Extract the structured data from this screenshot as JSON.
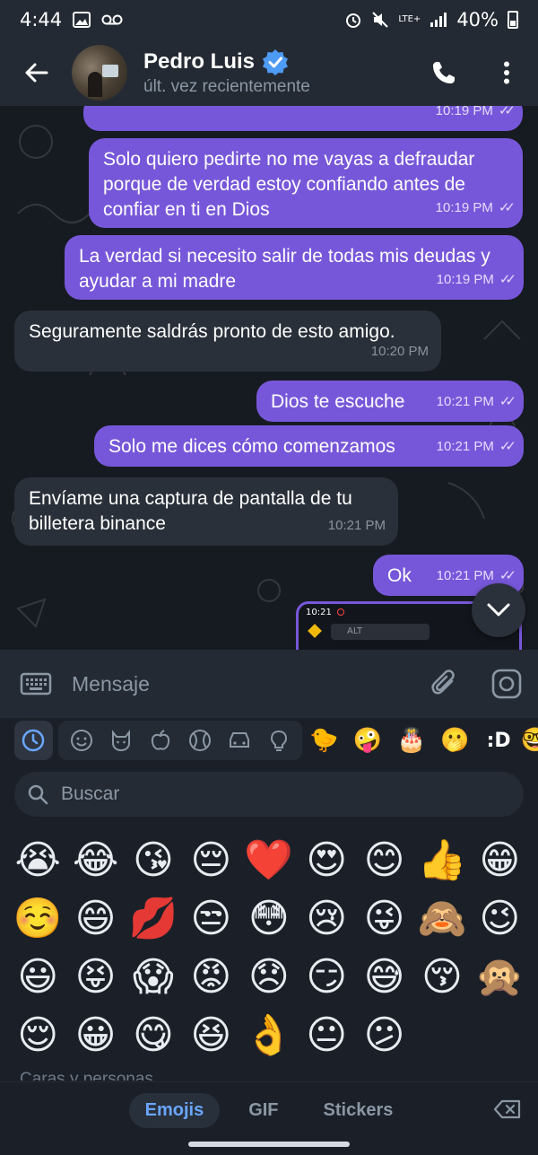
{
  "status_bar": {
    "time": "4:44",
    "network": "LTE+",
    "battery": "40%"
  },
  "header": {
    "contact_name": "Pedro Luis",
    "last_seen": "últ. vez recientemente"
  },
  "messages": [
    {
      "direction": "out",
      "text": "",
      "time": "10:19 PM",
      "read": true
    },
    {
      "direction": "out",
      "text": "Solo quiero pedirte no me vayas a defraudar porque de verdad estoy confiando antes de confiar en ti en Dios",
      "time": "10:19 PM",
      "read": true
    },
    {
      "direction": "out",
      "text": "La verdad si necesito salir de todas mis deudas y ayudar a mi madre",
      "time": "10:19 PM",
      "read": true
    },
    {
      "direction": "in",
      "text": "Seguramente saldrás pronto de esto amigo.",
      "time": "10:20 PM"
    },
    {
      "direction": "out",
      "text": "Dios te escuche",
      "time": "10:21 PM",
      "read": true
    },
    {
      "direction": "out",
      "text": "Solo me dices cómo comenzamos",
      "time": "10:21 PM",
      "read": true
    },
    {
      "direction": "in",
      "text": "Envíame una captura de pantalla de tu billetera binance",
      "time": "10:21 PM"
    },
    {
      "direction": "out",
      "text": "Ok",
      "time": "10:21 PM",
      "read": true
    }
  ],
  "screenshot_preview": {
    "time": "10:21",
    "search_text": "ALT"
  },
  "input": {
    "placeholder": "Mensaje"
  },
  "emoji_panel": {
    "search_placeholder": "Buscar",
    "category_sticker_emojis": [
      "🐤",
      "🤪",
      "🎂",
      "🫢",
      ":D",
      "🤓"
    ],
    "emojis": [
      "😭",
      "😂",
      "😘",
      "😔",
      "❤️",
      "😍",
      "😊",
      "👍",
      "😁",
      "☺️",
      "😄",
      "💋",
      "😒",
      "😳",
      "😢",
      "😜",
      "🙈",
      "😉",
      "😃",
      "😝",
      "😱",
      "😡",
      "😞",
      "😏",
      "😅",
      "😚",
      "🙊",
      "😌",
      "😀",
      "😋",
      "😆",
      "👌",
      "😐",
      "😕"
    ],
    "section_label": "Caras y personas",
    "tabs": [
      "Emojis",
      "GIF",
      "Stickers"
    ],
    "active_tab": "Emojis"
  },
  "colors": {
    "outgoing_bubble": "#7757d9",
    "incoming_bubble": "#2a3039",
    "header_bg": "#242a33",
    "chat_bg": "#161b22",
    "accent_blue": "#6aa6ff"
  }
}
